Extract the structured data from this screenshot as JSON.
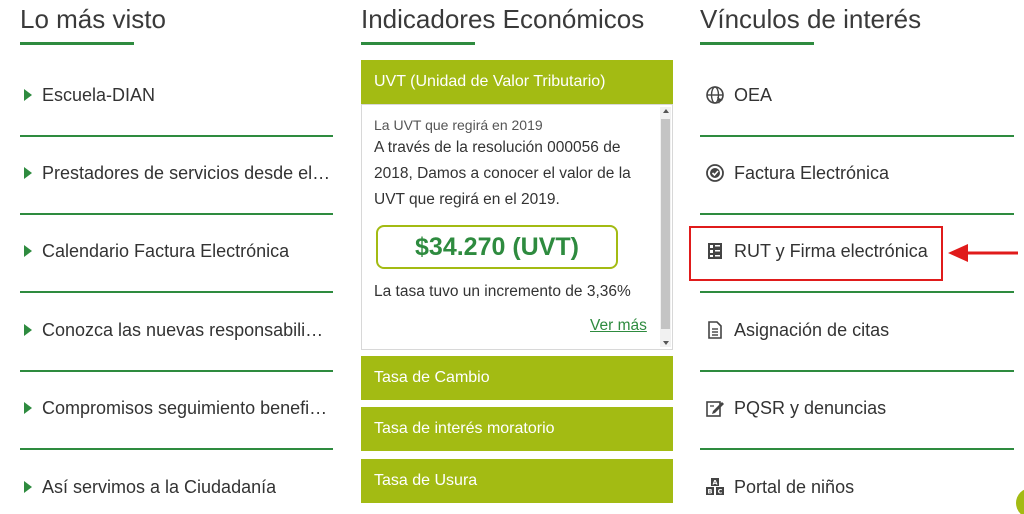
{
  "lo_mas_visto": {
    "title": "Lo más visto",
    "items": [
      {
        "label": "Escuela-DIAN"
      },
      {
        "label": "Prestadores de servicios desde el exterior"
      },
      {
        "label": "Calendario Factura Electrónica"
      },
      {
        "label": "Conozca las nuevas responsabilidades"
      },
      {
        "label": "Compromisos seguimiento beneficiarios"
      },
      {
        "label": "Así servimos a la Ciudadanía"
      }
    ]
  },
  "indicadores": {
    "title": "Indicadores Económicos",
    "uvt": {
      "header": "UVT (Unidad de Valor Tributario)",
      "subtitle": "La UVT que regirá en 2019",
      "description": "A través de la resolución 000056 de 2018, Damos a conocer el valor de la UVT que regirá en el 2019.",
      "value": "$34.270 (UVT)",
      "rate_text": "La tasa tuvo un incremento de 3,36%",
      "link": "Ver más"
    },
    "panels": [
      {
        "label": "Tasa de Cambio"
      },
      {
        "label": "Tasa de interés moratorio"
      },
      {
        "label": "Tasa de Usura"
      }
    ]
  },
  "vinculos": {
    "title": "Vínculos de interés",
    "items": [
      {
        "label": "OEA",
        "icon": "globe-icon"
      },
      {
        "label": "Factura Electrónica",
        "icon": "check-circle-icon"
      },
      {
        "label": "RUT y Firma electrónica",
        "icon": "id-card-icon"
      },
      {
        "label": "Asignación de citas",
        "icon": "document-icon"
      },
      {
        "label": "PQSR y denuncias",
        "icon": "edit-icon"
      },
      {
        "label": "Portal de niños",
        "icon": "abc-blocks-icon"
      }
    ]
  },
  "colors": {
    "accent_green": "#2e8b3f",
    "panel_green": "#a3bb13",
    "highlight_red": "#e01b1b"
  }
}
